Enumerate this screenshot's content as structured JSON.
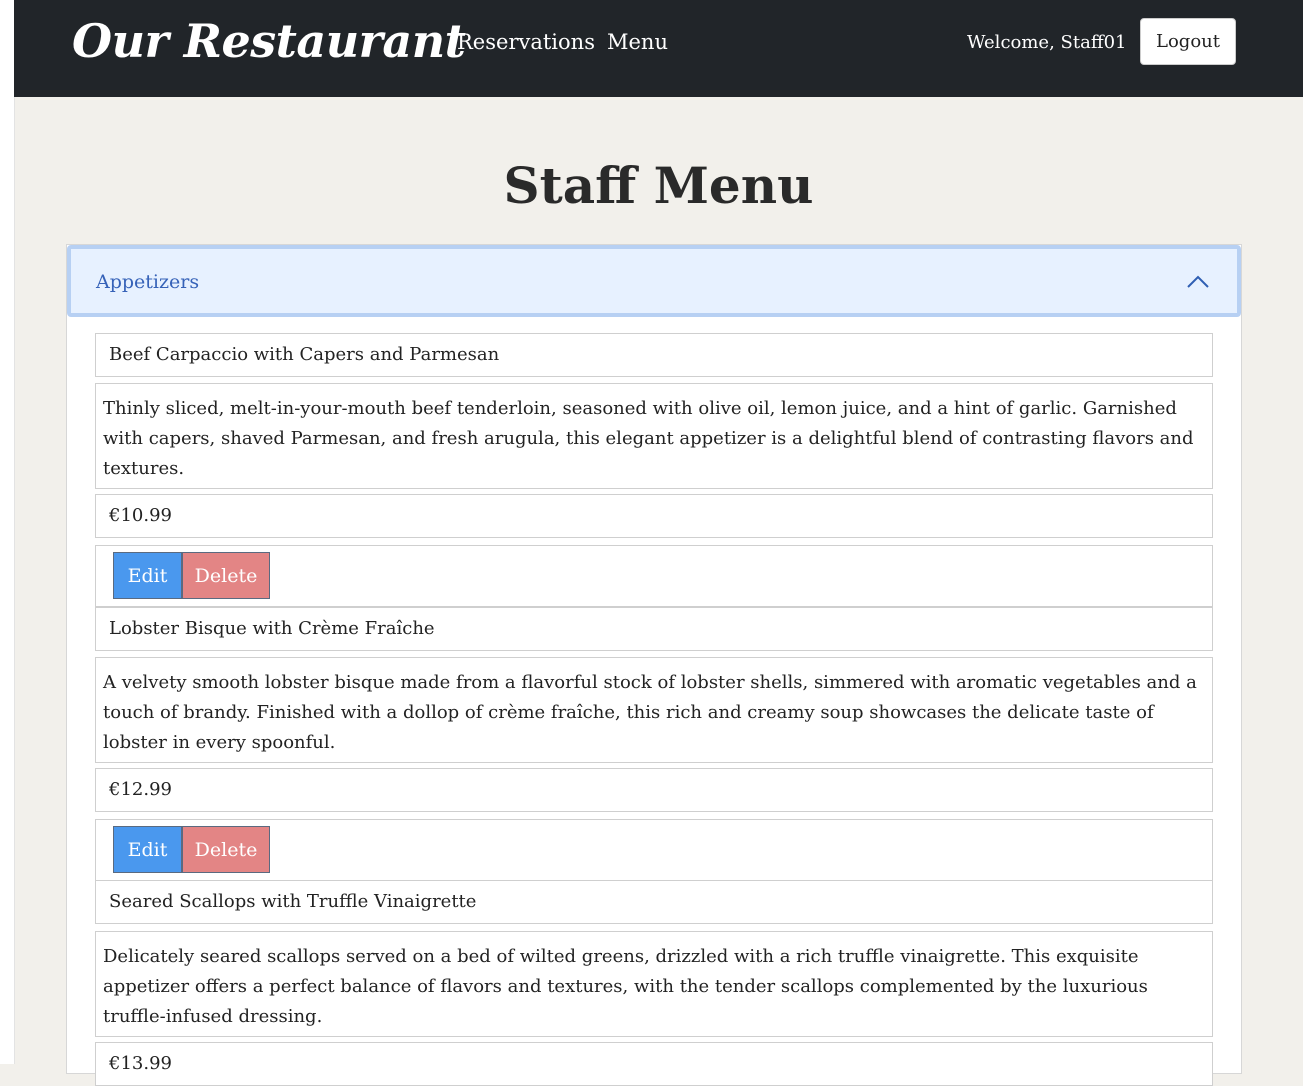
{
  "nav": {
    "brand": "Our Restaurant",
    "links": [
      "Reservations",
      "Menu"
    ],
    "welcome": "Welcome, Staff01",
    "logout": "Logout"
  },
  "page": {
    "title": "Staff Menu"
  },
  "category": {
    "title": "Appetizers",
    "expanded": true
  },
  "items": [
    {
      "name": "Beef Carpaccio with Capers and Parmesan",
      "description": " Thinly sliced, melt-in-your-mouth beef tenderloin, seasoned with olive oil, lemon juice, and a hint of garlic. Garnished with capers, shaved Parmesan, and fresh arugula, this elegant appetizer is a delightful blend of contrasting flavors and textures.",
      "price": "€10.99"
    },
    {
      "name": "Lobster Bisque with Crème Fraîche",
      "description": " A velvety smooth lobster bisque made from a flavorful stock of lobster shells, simmered with aromatic vegetables and a touch of brandy. Finished with a dollop of crème fraîche, this rich and creamy soup showcases the delicate taste of lobster in every spoonful.",
      "price": "€12.99"
    },
    {
      "name": "Seared Scallops with Truffle Vinaigrette",
      "description": " Delicately seared scallops served on a bed of wilted greens, drizzled with a rich truffle vinaigrette. This exquisite appetizer offers a perfect balance of flavors and textures, with the tender scallops complemented by the luxurious truffle-infused dressing.",
      "price": "€13.99"
    }
  ],
  "actions": {
    "edit": "Edit",
    "delete": "Delete"
  },
  "colors": {
    "navbar": "#212529",
    "background": "#f2f0eb",
    "accordion_header": "#e7f1ff",
    "accordion_title": "#3662b8",
    "edit_button": "#4a98ee",
    "delete_button": "#e38585"
  }
}
